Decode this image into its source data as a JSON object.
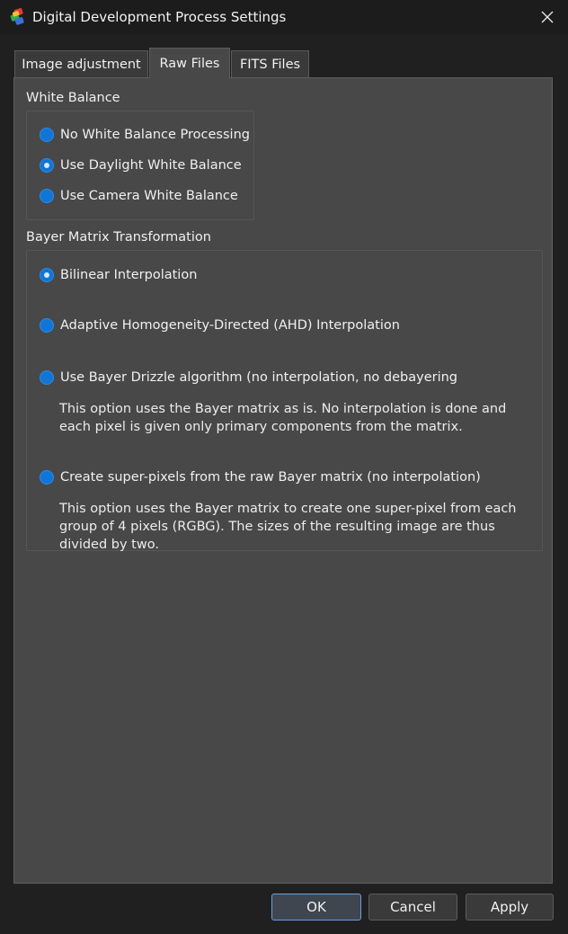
{
  "window": {
    "title": "Digital Development Process Settings"
  },
  "tabs": [
    {
      "label": "Image adjustment"
    },
    {
      "label": "Raw Files"
    },
    {
      "label": "FITS Files"
    }
  ],
  "active_tab": "Raw Files",
  "white_balance": {
    "label": "White Balance",
    "options": [
      {
        "label": "No White Balance Processing",
        "checked": false
      },
      {
        "label": "Use Daylight White Balance",
        "checked": true
      },
      {
        "label": "Use Camera White Balance",
        "checked": false
      }
    ]
  },
  "bayer": {
    "label": "Bayer Matrix Transformation",
    "options": [
      {
        "label": "Bilinear Interpolation",
        "checked": true,
        "description": ""
      },
      {
        "label": "Adaptive Homogeneity-Directed (AHD) Interpolation",
        "checked": false,
        "description": ""
      },
      {
        "label": "Use Bayer Drizzle algorithm (no interpolation, no debayering",
        "checked": false,
        "description": "This option uses the Bayer matrix as is. No interpolation is done and each pixel is given only primary components from the matrix."
      },
      {
        "label": "Create super-pixels from the raw Bayer matrix (no interpolation)",
        "checked": false,
        "description": "This option uses the Bayer matrix to create one super-pixel from each group of 4 pixels (RGBG). The sizes of the resulting image are thus divided by two."
      }
    ]
  },
  "buttons": {
    "ok": "OK",
    "cancel": "Cancel",
    "apply": "Apply"
  },
  "colors": {
    "accent": "#1175d6",
    "panel": "#484848",
    "window": "#202020"
  }
}
